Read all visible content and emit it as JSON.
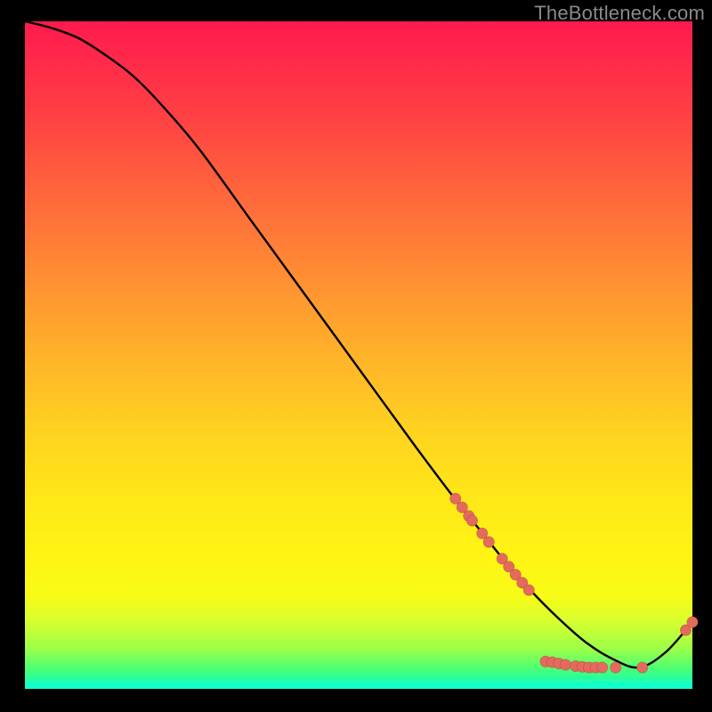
{
  "watermark": "TheBottleneck.com",
  "chart_data": {
    "type": "line",
    "title": "",
    "xlabel": "",
    "ylabel": "",
    "xlim": [
      0,
      100
    ],
    "ylim": [
      0,
      100
    ],
    "grid": false,
    "legend": false,
    "series": [
      {
        "name": "curve",
        "x": [
          0,
          4,
          8,
          12,
          16,
          20,
          26,
          34,
          42,
          50,
          58,
          64,
          68,
          72,
          76,
          80,
          84,
          88,
          92,
          96,
          100
        ],
        "y": [
          100,
          99,
          97.5,
          95,
          92,
          88,
          81,
          70,
          59,
          48,
          37,
          29,
          24,
          19,
          14.5,
          10.5,
          7,
          4.5,
          3.2,
          5.5,
          10
        ]
      }
    ],
    "markers": [
      {
        "x": 64.5,
        "y": 28.5
      },
      {
        "x": 65.5,
        "y": 27.2
      },
      {
        "x": 66.5,
        "y": 25.9
      },
      {
        "x": 67.0,
        "y": 25.2
      },
      {
        "x": 68.5,
        "y": 23.3
      },
      {
        "x": 69.5,
        "y": 22.0
      },
      {
        "x": 71.5,
        "y": 19.5
      },
      {
        "x": 72.5,
        "y": 18.3
      },
      {
        "x": 73.5,
        "y": 17.1
      },
      {
        "x": 74.5,
        "y": 15.9
      },
      {
        "x": 75.5,
        "y": 14.8
      },
      {
        "x": 78.0,
        "y": 4.1
      },
      {
        "x": 79.0,
        "y": 4.0
      },
      {
        "x": 80.0,
        "y": 3.8
      },
      {
        "x": 81.0,
        "y": 3.6
      },
      {
        "x": 82.5,
        "y": 3.4
      },
      {
        "x": 83.5,
        "y": 3.3
      },
      {
        "x": 84.5,
        "y": 3.2
      },
      {
        "x": 85.5,
        "y": 3.2
      },
      {
        "x": 86.5,
        "y": 3.2
      },
      {
        "x": 88.5,
        "y": 3.2
      },
      {
        "x": 92.5,
        "y": 3.2
      },
      {
        "x": 99.0,
        "y": 8.8
      },
      {
        "x": 100.0,
        "y": 10.0
      }
    ]
  }
}
